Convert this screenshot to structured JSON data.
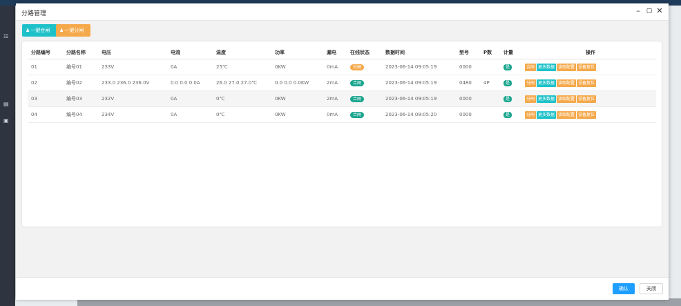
{
  "dialog": {
    "title": "分路管理",
    "toolbar": {
      "close_all": "一键合闸",
      "open_all": "一键分闸"
    },
    "footer": {
      "ok": "确认",
      "cancel": "关闭"
    }
  },
  "table": {
    "headers": [
      "分路编号",
      "分路名称",
      "电压",
      "电流",
      "温度",
      "功率",
      "漏电",
      "在线状态",
      "数据时间",
      "型号",
      "P数",
      "计量",
      "操作"
    ],
    "rows": [
      {
        "no": "01",
        "name": "编号01",
        "voltage": "233V",
        "current": "0A",
        "temp": "25℃",
        "power": "0KW",
        "leak": "0mA",
        "status": "分闸",
        "time": "2023-06-14 09:05:19",
        "model": "0000",
        "p": "",
        "metering": "是"
      },
      {
        "no": "02",
        "name": "编号02",
        "voltage": "233.0 236.0 236.0V",
        "current": "0.0 0.0 0.0A",
        "temp": "26.0 27.0 27.0℃",
        "power": "0.0 0.0 0.0KW",
        "leak": "2mA",
        "status": "合闸",
        "time": "2023-06-14 09:05:19",
        "model": "0480",
        "p": "4P",
        "metering": "是"
      },
      {
        "no": "03",
        "name": "编号03",
        "voltage": "232V",
        "current": "0A",
        "temp": "0℃",
        "power": "0KW",
        "leak": "2mA",
        "status": "合闸",
        "time": "2023-06-14 09:05:19",
        "model": "0000",
        "p": "",
        "metering": "是"
      },
      {
        "no": "04",
        "name": "编号04",
        "voltage": "234V",
        "current": "0A",
        "temp": "0℃",
        "power": "0KW",
        "leak": "0mA",
        "status": "合闸",
        "time": "2023-06-14 09:05:20",
        "model": "0000",
        "p": "",
        "metering": "是"
      }
    ],
    "ops": {
      "open": "分闸",
      "close": "合闸",
      "more": "更多数据",
      "read_config": "读取配置",
      "reset": "设备复位"
    }
  },
  "colors": {
    "teal": "#1fc1c9",
    "orange": "#f5a94b",
    "green": "#1aa58f",
    "blue": "#1e9fff"
  }
}
